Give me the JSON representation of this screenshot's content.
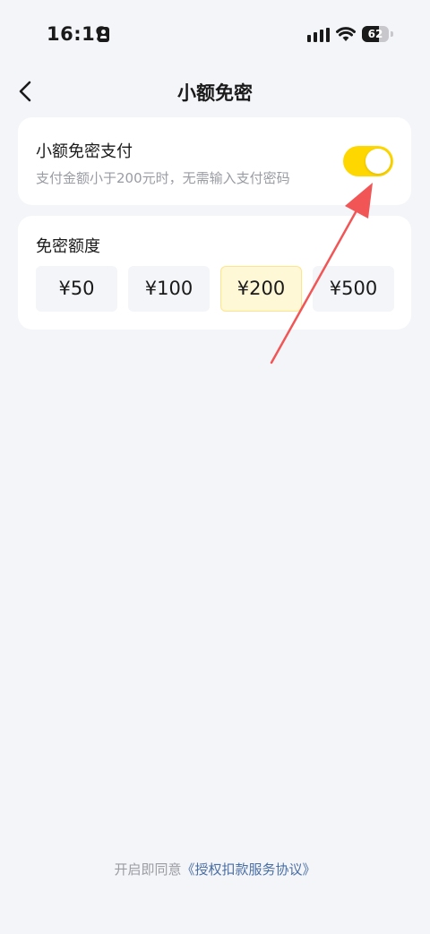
{
  "status_bar": {
    "time": "16:19",
    "battery_level": "62",
    "battery_fraction": 0.62,
    "icons": [
      "id-card-icon",
      "signal-icon",
      "wifi-icon",
      "battery-icon"
    ]
  },
  "nav": {
    "title": "小额免密",
    "back_icon": "chevron-left-icon"
  },
  "toggle_card": {
    "title": "小额免密支付",
    "description": "支付金额小于200元时，无需输入支付密码",
    "enabled": true,
    "on_color": "#FFD700"
  },
  "amount_card": {
    "title": "免密额度",
    "options": [
      {
        "label": "¥50",
        "selected": false
      },
      {
        "label": "¥100",
        "selected": false
      },
      {
        "label": "¥200",
        "selected": true
      },
      {
        "label": "¥500",
        "selected": false
      }
    ],
    "selected_bg": "#FFF8D6"
  },
  "annotation": {
    "type": "arrow",
    "color": "#F25555",
    "points_to": "toggle-switch"
  },
  "footer": {
    "prefix": "开启即同意",
    "link": "《授权扣款服务协议》",
    "link_color": "#4A6FA5"
  }
}
